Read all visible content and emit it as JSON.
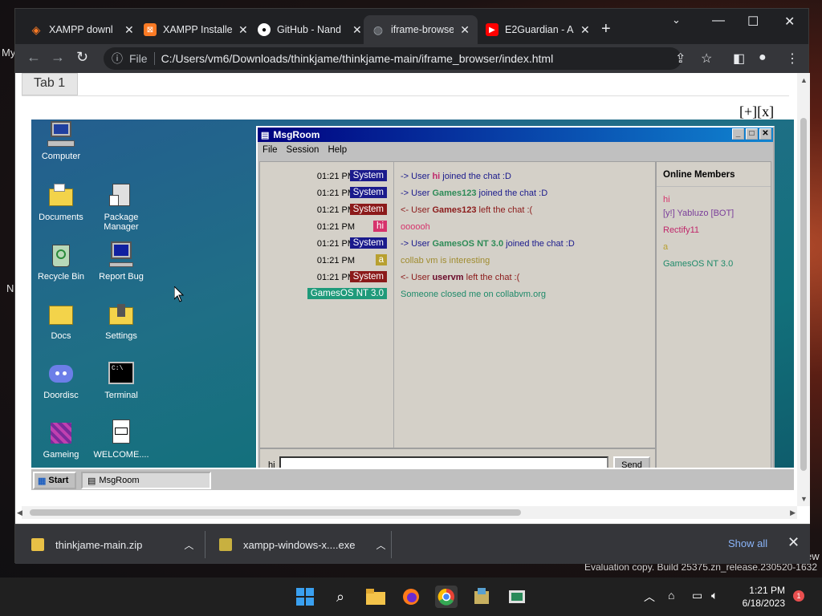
{
  "browser": {
    "tabs": [
      {
        "title": "XAMPP downl",
        "icon": "xampp-icon",
        "color": "#fb7a24"
      },
      {
        "title": "XAMPP Installe",
        "icon": "xampp-icon",
        "color": "#fb7a24"
      },
      {
        "title": "GitHub - Nand",
        "icon": "github-icon",
        "color": "#ffffff"
      },
      {
        "title": "iframe-browse",
        "icon": "globe-icon",
        "color": "#9aa0a6"
      },
      {
        "title": "E2Guardian - A",
        "icon": "youtube-icon",
        "color": "#ff0000"
      }
    ],
    "address": {
      "scheme_label": "File",
      "url": "C:/Users/vm6/Downloads/thinkjame/thinkjame-main/iframe_browser/index.html"
    }
  },
  "page": {
    "tab_label": "Tab 1",
    "frame_controls": "[+][x]"
  },
  "vm": {
    "desktop_icons": [
      {
        "label": "Computer"
      },
      {
        "label": "Documents"
      },
      {
        "label": "Package Manager"
      },
      {
        "label": "Recycle Bin"
      },
      {
        "label": "Report Bug"
      },
      {
        "label": "Docs"
      },
      {
        "label": "Settings"
      },
      {
        "label": "Doordisc"
      },
      {
        "label": "Terminal"
      },
      {
        "label": "Gameing"
      },
      {
        "label": "WELCOME...."
      }
    ],
    "taskbar": {
      "start_label": "Start",
      "task_label": "MsgRoom"
    },
    "msgroom": {
      "title": "MsgRoom",
      "menu": [
        "File",
        "Session",
        "Help"
      ],
      "messages": [
        {
          "time": "01:21 PM",
          "user": "System",
          "badge_color": "#1a1a8c",
          "prefix": "-> User ",
          "name": "hi",
          "suffix": " joined the chat :D",
          "color": "#1a1a8c",
          "name_color": "#c0286b"
        },
        {
          "time": "01:21 PM",
          "user": "System",
          "badge_color": "#1a1a8c",
          "prefix": "-> User ",
          "name": "Games123",
          "suffix": " joined the chat :D",
          "color": "#1a1a8c",
          "name_color": "#2e8b57"
        },
        {
          "time": "01:21 PM",
          "user": "System",
          "badge_color": "#8b1a1a",
          "prefix": "<- User ",
          "name": "Games123",
          "suffix": " left the chat :(",
          "color": "#8b1a1a",
          "name_color": "#8b1a1a"
        },
        {
          "time": "01:21 PM",
          "user": "hi",
          "badge_color": "#d6336c",
          "prefix": "",
          "name": "",
          "suffix": "oooooh",
          "color": "#d6336c",
          "name_color": "#d6336c"
        },
        {
          "time": "01:21 PM",
          "user": "System",
          "badge_color": "#1a1a8c",
          "prefix": "-> User ",
          "name": "GamesOS NT 3.0",
          "suffix": " joined the chat :D",
          "color": "#1a1a8c",
          "name_color": "#2e8b57"
        },
        {
          "time": "01:21 PM",
          "user": "a",
          "badge_color": "#b8a030",
          "prefix": "",
          "name": "",
          "suffix": "collab vm is interesting",
          "color": "#a08c30",
          "name_color": "#a08c30"
        },
        {
          "time": "01:21 PM",
          "user": "System",
          "badge_color": "#8b1a1a",
          "prefix": "<- User ",
          "name": "uservm",
          "suffix": " left the chat :(",
          "color": "#8b1a1a",
          "name_color": "#6a0a2a"
        },
        {
          "time": "01:21 PM",
          "user": "GamesOS NT 3.0",
          "badge_color": "#1f9a7a",
          "prefix": "",
          "name": "",
          "suffix": "Someone closed me on collabvm.org",
          "color": "#1f8a6a",
          "name_color": "#1f8a6a"
        }
      ],
      "members_header": "Online Members",
      "members": [
        {
          "name": "hi",
          "color": "#d6336c"
        },
        {
          "name": "[y!] Yabluzo [BOT]",
          "color": "#7a3d9a"
        },
        {
          "name": "Rectify11",
          "color": "#c0286b"
        },
        {
          "name": "a",
          "color": "#b8a030"
        },
        {
          "name": "GamesOS NT 3.0",
          "color": "#1f8a6a"
        }
      ],
      "input_nick": "hi",
      "input_value": "",
      "send_label": "Send"
    }
  },
  "downloads": [
    {
      "name": "thinkjame-main.zip"
    },
    {
      "name": "xampp-windows-x....exe"
    }
  ],
  "downloads_show_all": "Show all",
  "host": {
    "side_label_1": "My",
    "side_label_2": "N",
    "side_label_3": "ew",
    "eval_text": "Evaluation copy. Build 25375.zn_release.230520-1632",
    "time": "1:21 PM",
    "date": "6/18/2023",
    "notif_count": "1"
  }
}
